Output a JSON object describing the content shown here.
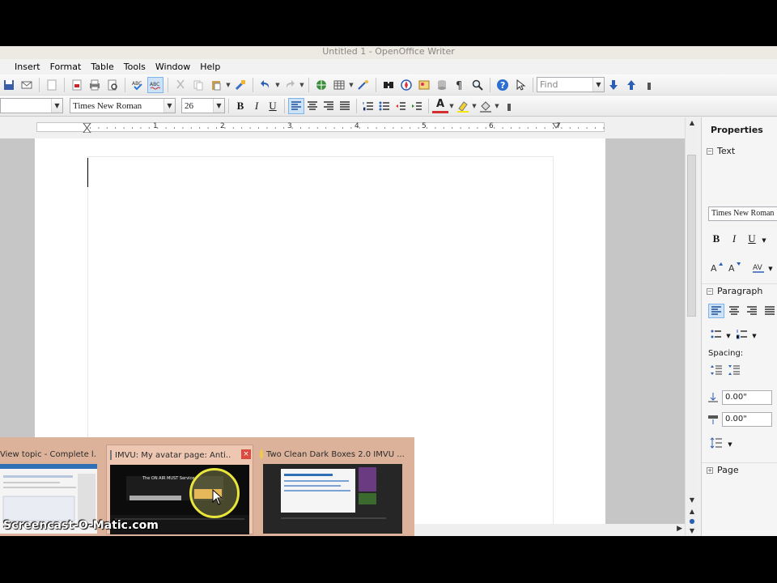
{
  "window": {
    "title": "Untitled 1 - OpenOffice Writer"
  },
  "menu": [
    {
      "label": "Insert"
    },
    {
      "label": "Format"
    },
    {
      "label": "Table"
    },
    {
      "label": "Tools"
    },
    {
      "label": "Window"
    },
    {
      "label": "Help"
    }
  ],
  "toolbar": {
    "find_placeholder": "Find",
    "font_name": "Times New Roman",
    "font_size": "26",
    "bold": "B",
    "italic": "I",
    "underline": "U",
    "font_color_letter": "A"
  },
  "ruler": {
    "numbers": [
      "1",
      "2",
      "3",
      "4",
      "5",
      "6",
      "7"
    ]
  },
  "sidebar": {
    "title": "Properties",
    "text_section": "Text",
    "font_name": "Times New Roman",
    "bold": "B",
    "italic": "I",
    "underline": "U",
    "paragraph_section": "Paragraph",
    "spacing_label": "Spacing:",
    "spacing_above": "0.00\"",
    "spacing_below": "0.00\"",
    "page_section": "Page"
  },
  "taskbar_thumbnails": [
    {
      "title": "View topic - Complete l..."
    },
    {
      "title": "IMVU: My avatar page: Anti..."
    },
    {
      "title": "Two Clean Dark Boxes 2.0 IMVU ..."
    }
  ],
  "thumbnail_inner_text": "The ON AIR MUST Service",
  "watermark": "Screencast-O-Matic.com",
  "colors": {
    "popup_bg": "#dcb39a",
    "highlight": "#cde2f7",
    "cursor_ring": "#e8e63a"
  }
}
